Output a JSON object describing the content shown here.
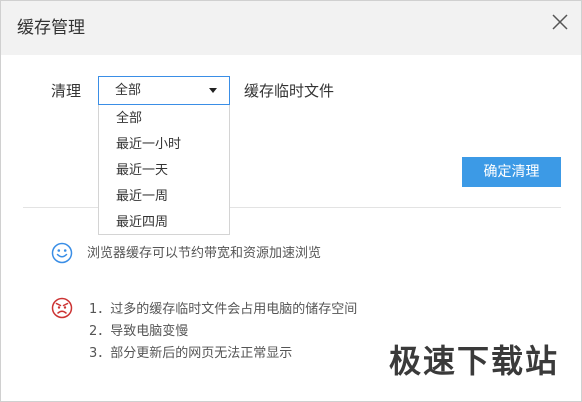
{
  "dialog": {
    "title": "缓存管理"
  },
  "clean": {
    "label": "清理",
    "selected": "全部",
    "description": "缓存临时文件",
    "options": [
      "全部",
      "最近一小时",
      "最近一天",
      "最近一周",
      "最近四周"
    ],
    "confirm_label": "确定清理"
  },
  "info": {
    "icon": "smile-icon",
    "text": "浏览器缓存可以节约带宽和资源加速浏览"
  },
  "warnings": {
    "icon": "angry-icon",
    "lines": [
      "1．过多的缓存临时文件会占用电脑的储存空间",
      "2．导致电脑变慢",
      "3．部分更新后的网页无法正常显示"
    ]
  },
  "watermark": {
    "text": "极速下载站"
  },
  "colors": {
    "accent": "#3c9ae6",
    "select_border": "#3a8ee6",
    "smile": "#3a8ee6",
    "angry": "#cc3333"
  }
}
